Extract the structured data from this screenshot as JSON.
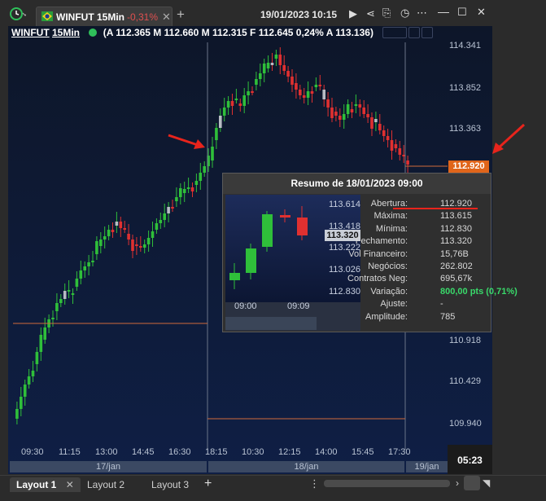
{
  "window": {
    "datetime": "19/01/2023 10:15",
    "tab": {
      "name": "WINFUT 15Min",
      "change": "-0,31%"
    }
  },
  "infobar": {
    "symbol": "WINFUT",
    "interval": "15Min",
    "quote": "(A 112.365 M 112.660 M 112.315 F 112.645 0,24% A 113.136)"
  },
  "axis": {
    "price_labels": [
      "114.341",
      "113.852",
      "113.363",
      "110.918",
      "110.429",
      "109.940"
    ],
    "time_labels": [
      "09:30",
      "11:15",
      "13:00",
      "14:45",
      "16:30",
      "18:15",
      "10:30",
      "12:15",
      "14:00",
      "15:45",
      "17:30"
    ],
    "date_labels": [
      "17/jan",
      "18/jan",
      "19/jan"
    ],
    "current_price": "112.920",
    "clock": "05:23"
  },
  "popup": {
    "title": "Resumo de 18/01/2023 09:00",
    "mini_price_labels": [
      "113.614",
      "113.418",
      "113.222",
      "113.026",
      "112.830"
    ],
    "mini_tag": "113.320",
    "mini_time_labels": [
      "09:00",
      "09:09"
    ],
    "rows": [
      {
        "label": "Abertura:",
        "value": "112.920"
      },
      {
        "label": "Máxima:",
        "value": "113.615"
      },
      {
        "label": "Mínima:",
        "value": "112.830"
      },
      {
        "label": "Fechamento:",
        "value": "113.320"
      },
      {
        "label": "Vol Financeiro:",
        "value": "15,76B"
      },
      {
        "label": "Negócios:",
        "value": "262.802"
      },
      {
        "label": "Contratos Neg:",
        "value": "695,67k"
      },
      {
        "label": "Variação:",
        "value": "800,00 pts (0,71%)"
      },
      {
        "label": "Ajuste:",
        "value": "-"
      },
      {
        "label": "Amplitude:",
        "value": "785"
      }
    ]
  },
  "layouts": [
    "Layout 1",
    "Layout 2",
    "Layout 3"
  ],
  "colors": {
    "up": "#2fbf3a",
    "down": "#e03030",
    "accent": "#e0651a",
    "bg": "#0d1a36"
  }
}
